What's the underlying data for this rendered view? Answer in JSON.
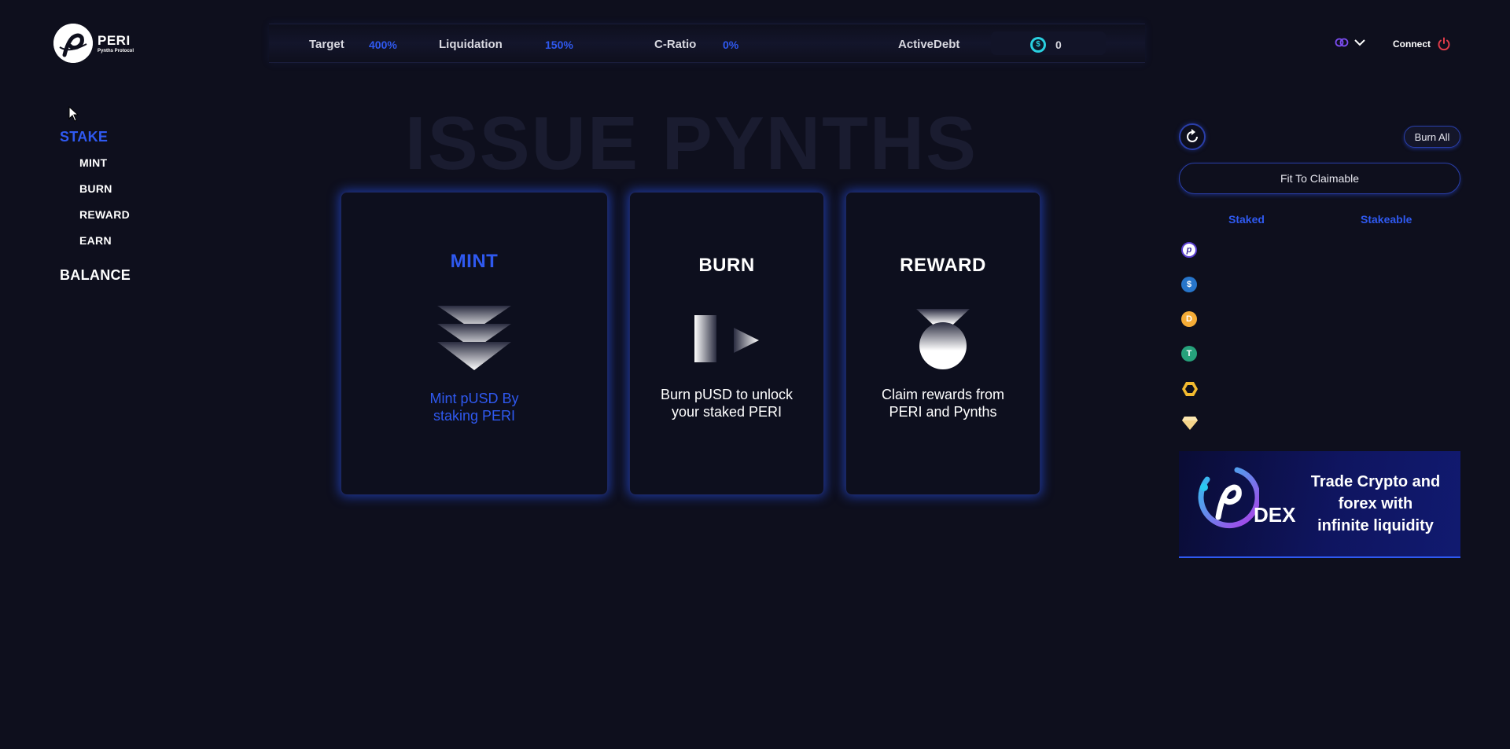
{
  "brand": {
    "name": "PERI",
    "tagline": "Pynths Protocol"
  },
  "nav": {
    "stake": "STAKE",
    "sub_items": [
      "MINT",
      "BURN",
      "REWARD",
      "EARN"
    ],
    "balance": "BALANCE"
  },
  "stats": {
    "target_label": "Target",
    "target_value": "400%",
    "liquidation_label": "Liquidation",
    "liquidation_value": "150%",
    "cratio_label": "C-Ratio",
    "cratio_value": "0%",
    "activedebt_label": "ActiveDebt",
    "activedebt_value": "0"
  },
  "header": {
    "connect_label": "Connect",
    "network_icon": "link-icon",
    "power_icon": "power-icon"
  },
  "page_title": "ISSUE PYNTHS",
  "cards": {
    "mint": {
      "title": "MINT",
      "line1": "Mint pUSD By",
      "line2": "staking PERI"
    },
    "burn": {
      "title": "BURN",
      "line1": "Burn pUSD to unlock",
      "line2": "your staked PERI"
    },
    "reward": {
      "title": "REWARD",
      "line1": "Claim rewards from",
      "line2": "PERI and Pynths"
    }
  },
  "panel": {
    "burn_all_label": "Burn All",
    "fit_label": "Fit To Claimable",
    "tab_staked": "Staked",
    "tab_stakeable": "Stakeable",
    "tokens": [
      "peri-token-icon",
      "usdc-token-icon",
      "dai-token-icon",
      "usdt-token-icon",
      "bnb-token-icon",
      "diamond-token-icon"
    ]
  },
  "banner": {
    "dex_label": "DEX",
    "line1": "Trade Crypto and",
    "line2": "forex with",
    "line3": "infinite liquidity"
  },
  "colors": {
    "accent": "#2f59f0",
    "background": "#0e0f1d",
    "title_ghost": "#1a1c30"
  }
}
